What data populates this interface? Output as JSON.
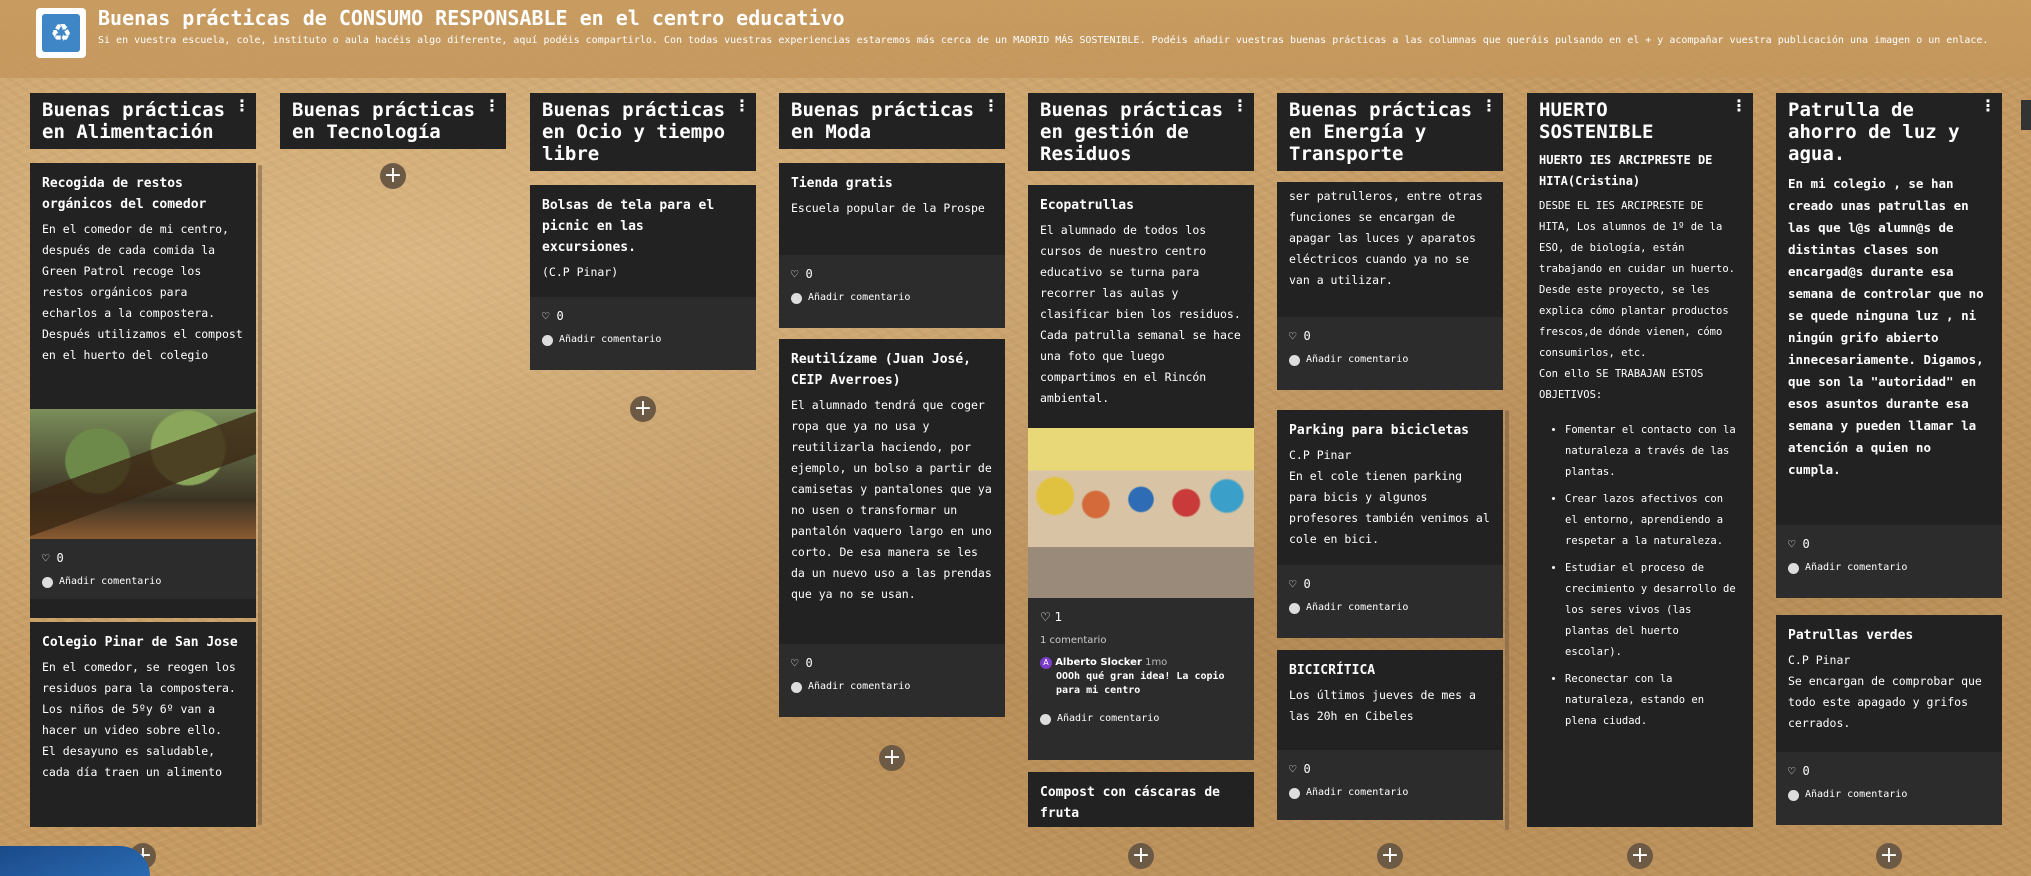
{
  "header": {
    "title": "Buenas prácticas de CONSUMO RESPONSABLE en el centro educativo",
    "description": "Si en vuestra escuela, cole, instituto o aula hacéis algo diferente, aquí podéis compartirlo. Con todas vuestras experiencias estaremos más cerca de un MADRID MÁS SOSTENIBLE. Podéis añadir vuestras buenas prácticas a las columnas que queráis pulsando en el + y acompañar vuestra publicación una imagen o un enlace.",
    "logo_icon": "recycle-bin-icon"
  },
  "columns": [
    {
      "title": "Buenas prácticas en Alimentación"
    },
    {
      "title": "Buenas prácticas en Tecnología"
    },
    {
      "title": "Buenas prácticas en Ocio y tiempo libre"
    },
    {
      "title": "Buenas prácticas en Moda"
    },
    {
      "title": "Buenas prácticas en gestión de Residuos"
    },
    {
      "title": "Buenas prácticas en Energía y Transporte"
    },
    {
      "title": "HUERTO SOSTENIBLE"
    },
    {
      "title": "Patrulla de ahorro de luz y agua."
    }
  ],
  "common": {
    "add_comment": "Añadir comentario",
    "plus": "+",
    "menu": "⋮",
    "heart": "♡"
  },
  "cards": {
    "alim1": {
      "title": "Recogida de restos orgánicos del comedor",
      "text": "En el comedor de mi centro, después de cada comida la Green Patrol recoge los restos orgánicos para echarlos a la compostera. Después utilizamos el compost en el huerto del colegio",
      "likes": "0"
    },
    "alim2": {
      "title": "Colegio Pinar de San Jose",
      "text": "En el comedor, se reogen los residuos para la compostera. Los niños de 5ºy 6º van a hacer un video sobre ello.\nEl desayuno es saludable, cada día traen un alimento"
    },
    "ocio1": {
      "title": "Bolsas de tela para el picnic en las excursiones.",
      "text": "(C.P Pinar)",
      "likes": "0"
    },
    "moda1": {
      "title": "Tienda gratis",
      "text": "Escuela popular de la Prospe",
      "likes": "0"
    },
    "moda2": {
      "title": "Reutilízame (Juan José, CEIP Averroes)",
      "text": "El alumnado tendrá que coger ropa que ya no usa y reutilizarla haciendo, por ejemplo, un bolso a partir de camisetas y pantalones que ya no usen o transformar un pantalón vaquero largo en uno corto. De esa manera se les da un nuevo uso a las prendas que ya no se usan.",
      "likes": "0"
    },
    "res1": {
      "title": "Ecopatrullas",
      "text": "El alumnado de todos los cursos de nuestro centro educativo se turna para recorrer las aulas y clasificar bien los residuos. Cada patrulla semanal se hace una foto que luego compartimos en el Rincón ambiental.",
      "likes": "1",
      "comments_count": "1 comentario",
      "comment_author": "Alberto Slocker",
      "comment_time": "1mo",
      "comment_text": "OOOh qué gran idea! La copio para mi centro",
      "avatar_letter": "A"
    },
    "res2": {
      "title": "Compost con cáscaras de fruta"
    },
    "ener1": {
      "text": "ser patrulleros, entre otras funciones se encargan de apagar las luces y aparatos eléctricos cuando ya no se van a utilizar.",
      "likes": "0"
    },
    "ener2": {
      "title": "Parking para bicicletas",
      "text": "C.P Pinar\nEn el cole tienen parking para bicis y algunos profesores también venimos al cole en bici.",
      "likes": "0"
    },
    "ener3": {
      "title": "BICICRÍTICA",
      "text": "Los últimos jueves de mes a las 20h en Cibeles",
      "likes": "0"
    },
    "huerto1": {
      "title": "HUERTO IES ARCIPRESTE DE HITA(Cristina)",
      "text": "DESDE EL IES ARCIPRESTE DE HITA, Los alumnos de 1º de la ESO, de biología, están trabajando en cuidar un huerto. Desde este proyecto, se les explica cómo plantar productos frescos,de dónde vienen, cómo consumirlos, etc.\nCon ello SE TRABAJAN ESTOS OBJETIVOS:",
      "bullets": [
        "Fomentar el contacto con la naturaleza a través de las plantas.",
        "Crear lazos afectivos con el entorno, aprendiendo a respetar a la naturaleza.",
        "Estudiar el proceso de crecimiento y desarrollo de los seres vivos (las plantas del huerto escolar).",
        "Reconectar con la naturaleza, estando en plena ciudad."
      ]
    },
    "patrulla1": {
      "text": "En mi colegio , se han creado unas patrullas en las que l@s alumn@s de distintas clases son encargad@s durante esa semana de controlar que no se quede ninguna luz , ni ningún grifo abierto innecesariamente. Digamos, que son la \"autoridad\" en esos asuntos durante esa semana y pueden llamar la atención a quien no cumpla.",
      "likes": "0"
    },
    "patrulla2": {
      "title": "Patrullas verdes",
      "text": "C.P Pinar\nSe encargan de comprobar que todo este apagado y grifos cerrados.",
      "likes": "0"
    }
  }
}
